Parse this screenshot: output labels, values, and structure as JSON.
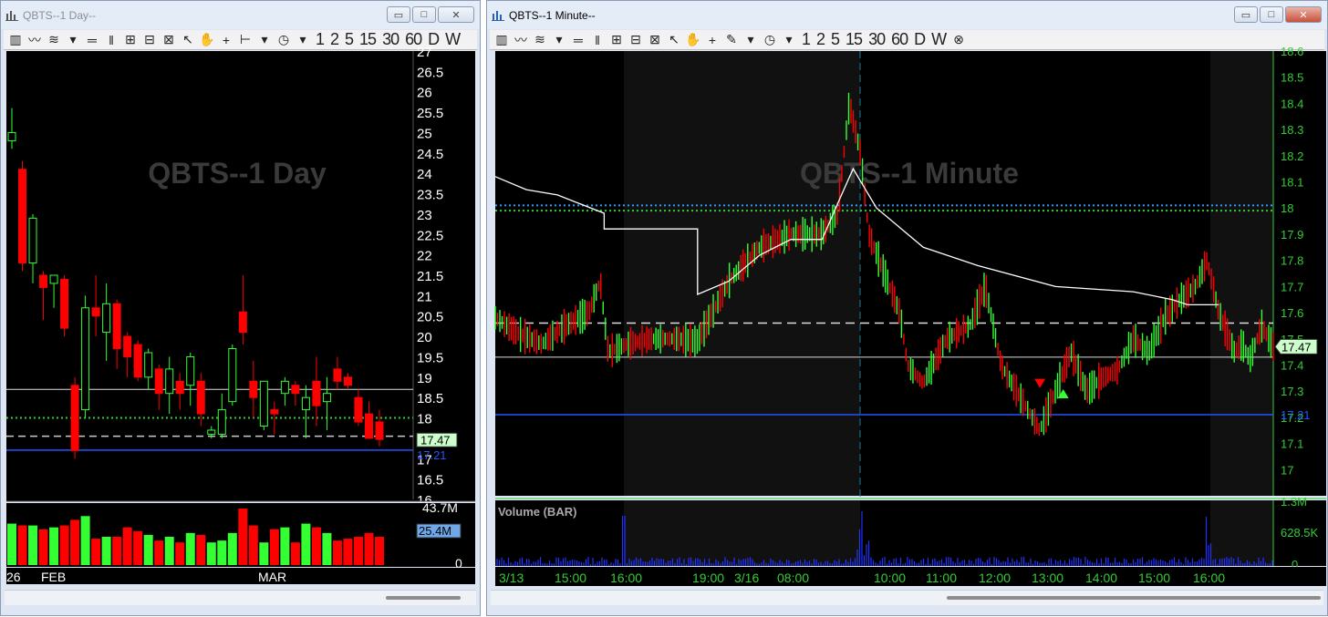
{
  "windows": {
    "day": {
      "title": "QBTS--1 Day--",
      "min": "▭",
      "max": "□",
      "close": "✕"
    },
    "minute": {
      "title": "QBTS--1 Minute--",
      "min": "▭",
      "max": "□",
      "close": "✕"
    }
  },
  "toolbar": {
    "timeframes_day": [
      "1",
      "2",
      "5",
      "15",
      "30",
      "60",
      "D",
      "W"
    ],
    "timeframes_minute": [
      "1",
      "2",
      "5",
      "15",
      "30",
      "60",
      "D",
      "W"
    ]
  },
  "colors": {
    "up": "#33ff33",
    "down": "#ff0000",
    "vwap": "#ffffff",
    "blue_line": "#2255ff",
    "dotted_green": "#33cc33",
    "dotted_blue": "#3399ff",
    "axis_minute": "#33cc33",
    "axis_day": "#ffffff",
    "last_price_tag": "#ccffcc"
  },
  "chart_data": [
    {
      "type": "candlestick",
      "title": "QBTS--1 Day",
      "y_ticks": [
        "27",
        "26.5",
        "26",
        "25.5",
        "25",
        "24.5",
        "24",
        "23.5",
        "23",
        "22.5",
        "22",
        "21.5",
        "21",
        "20.5",
        "20",
        "19.5",
        "19",
        "18.5",
        "18",
        "17.5",
        "17",
        "16.5",
        "16"
      ],
      "ylim": [
        16,
        27
      ],
      "x_labels": [
        "26",
        "FEB",
        "MAR"
      ],
      "last_price": "17.47",
      "blue_level_label": "17.21",
      "levels": {
        "white": 18.7,
        "dotted_green": 18.0,
        "dashed": 17.55,
        "blue": 17.21
      },
      "candles": [
        {
          "o": 24.8,
          "h": 25.6,
          "l": 24.6,
          "c": 25.0
        },
        {
          "o": 24.1,
          "h": 24.3,
          "l": 21.6,
          "c": 21.8
        },
        {
          "o": 21.8,
          "h": 23.0,
          "l": 21.3,
          "c": 22.9
        },
        {
          "o": 21.5,
          "h": 21.6,
          "l": 20.4,
          "c": 21.2
        },
        {
          "o": 21.3,
          "h": 21.5,
          "l": 20.7,
          "c": 21.5
        },
        {
          "o": 21.4,
          "h": 21.5,
          "l": 20.0,
          "c": 20.2
        },
        {
          "o": 18.8,
          "h": 19.0,
          "l": 17.0,
          "c": 17.2
        },
        {
          "o": 18.2,
          "h": 21.0,
          "l": 18.0,
          "c": 20.7
        },
        {
          "o": 20.7,
          "h": 21.5,
          "l": 20.0,
          "c": 20.5
        },
        {
          "o": 20.1,
          "h": 21.3,
          "l": 19.4,
          "c": 20.8
        },
        {
          "o": 20.8,
          "h": 20.9,
          "l": 19.2,
          "c": 19.7
        },
        {
          "o": 20.0,
          "h": 20.1,
          "l": 19.0,
          "c": 19.5
        },
        {
          "o": 19.8,
          "h": 19.9,
          "l": 18.9,
          "c": 19.0
        },
        {
          "o": 19.0,
          "h": 19.7,
          "l": 18.7,
          "c": 19.6
        },
        {
          "o": 19.2,
          "h": 19.3,
          "l": 18.2,
          "c": 18.6
        },
        {
          "o": 18.6,
          "h": 19.5,
          "l": 18.1,
          "c": 19.2
        },
        {
          "o": 18.9,
          "h": 19.1,
          "l": 18.2,
          "c": 18.6
        },
        {
          "o": 18.8,
          "h": 19.6,
          "l": 18.3,
          "c": 19.5
        },
        {
          "o": 18.9,
          "h": 19.1,
          "l": 17.8,
          "c": 18.1
        },
        {
          "o": 17.6,
          "h": 17.8,
          "l": 17.5,
          "c": 17.7
        },
        {
          "o": 17.6,
          "h": 18.6,
          "l": 17.5,
          "c": 18.2
        },
        {
          "o": 18.4,
          "h": 19.8,
          "l": 18.3,
          "c": 19.7
        },
        {
          "o": 20.6,
          "h": 21.5,
          "l": 19.8,
          "c": 20.1
        },
        {
          "o": 18.9,
          "h": 19.4,
          "l": 18.0,
          "c": 18.5
        },
        {
          "o": 17.8,
          "h": 18.9,
          "l": 17.7,
          "c": 18.9
        },
        {
          "o": 18.2,
          "h": 18.4,
          "l": 17.6,
          "c": 18.1
        },
        {
          "o": 18.6,
          "h": 19.0,
          "l": 18.3,
          "c": 18.9
        },
        {
          "o": 18.8,
          "h": 18.9,
          "l": 18.3,
          "c": 18.6
        },
        {
          "o": 18.2,
          "h": 18.8,
          "l": 17.5,
          "c": 18.5
        },
        {
          "o": 18.9,
          "h": 19.5,
          "l": 17.8,
          "c": 18.3
        },
        {
          "o": 18.4,
          "h": 19.0,
          "l": 17.7,
          "c": 18.6
        },
        {
          "o": 19.2,
          "h": 19.5,
          "l": 18.7,
          "c": 18.9
        },
        {
          "o": 19.0,
          "h": 19.1,
          "l": 18.7,
          "c": 18.8
        },
        {
          "o": 18.5,
          "h": 18.7,
          "l": 17.8,
          "c": 17.9
        },
        {
          "o": 18.1,
          "h": 18.4,
          "l": 17.7,
          "c": 17.5
        },
        {
          "o": 17.9,
          "h": 18.2,
          "l": 17.3,
          "c": 17.47
        }
      ],
      "volume": {
        "top_label": "43.7M",
        "tag_label": "25.4M",
        "zero_label": "0",
        "values": [
          22,
          21,
          21,
          19,
          20,
          21,
          24,
          26,
          14,
          15,
          15,
          20,
          18,
          16,
          13,
          15,
          12,
          17,
          16,
          12,
          13,
          17,
          30,
          21,
          12,
          19,
          20,
          12,
          22,
          20,
          17,
          13,
          14,
          15,
          17,
          15
        ]
      }
    },
    {
      "type": "candlestick",
      "title": "QBTS--1 Minute",
      "y_ticks": [
        "18.6",
        "18.5",
        "18.4",
        "18.3",
        "18.2",
        "18.1",
        "18",
        "17.9",
        "17.8",
        "17.7",
        "17.6",
        "17.5",
        "17.4",
        "17.3",
        "17.2",
        "17.1",
        "17"
      ],
      "ylim": [
        16.9,
        18.6
      ],
      "x_labels": [
        "3/13",
        "15:00",
        "16:00",
        "19:00",
        "3/16",
        "08:00",
        "10:00",
        "11:00",
        "12:00",
        "13:00",
        "14:00",
        "15:00",
        "16:00"
      ],
      "last_price": "17.47",
      "blue_level_label": "17.21",
      "levels": {
        "dotted_blue": 18.01,
        "dotted_green": 17.99,
        "dashed": 17.56,
        "white": 17.43,
        "blue": 17.21
      },
      "vwap": [
        [
          0,
          18.12
        ],
        [
          0.04,
          18.07
        ],
        [
          0.08,
          18.05
        ],
        [
          0.14,
          17.98
        ],
        [
          0.14,
          17.92
        ],
        [
          0.26,
          17.92
        ],
        [
          0.26,
          17.67
        ],
        [
          0.3,
          17.72
        ],
        [
          0.34,
          17.82
        ],
        [
          0.38,
          17.88
        ],
        [
          0.42,
          17.88
        ],
        [
          0.445,
          18.05
        ],
        [
          0.46,
          18.15
        ],
        [
          0.49,
          18.0
        ],
        [
          0.55,
          17.85
        ],
        [
          0.62,
          17.78
        ],
        [
          0.72,
          17.7
        ],
        [
          0.82,
          17.68
        ],
        [
          0.87,
          17.65
        ],
        [
          0.89,
          17.63
        ],
        [
          0.93,
          17.63
        ]
      ],
      "price_path": [
        [
          0,
          17.58
        ],
        [
          0.03,
          17.52
        ],
        [
          0.06,
          17.48
        ],
        [
          0.09,
          17.55
        ],
        [
          0.12,
          17.6
        ],
        [
          0.135,
          17.72
        ],
        [
          0.14,
          17.58
        ],
        [
          0.145,
          17.45
        ],
        [
          0.17,
          17.48
        ],
        [
          0.2,
          17.5
        ],
        [
          0.235,
          17.5
        ],
        [
          0.26,
          17.49
        ],
        [
          0.3,
          17.72
        ],
        [
          0.34,
          17.85
        ],
        [
          0.38,
          17.9
        ],
        [
          0.42,
          17.9
        ],
        [
          0.44,
          17.98
        ],
        [
          0.455,
          18.4
        ],
        [
          0.47,
          18.2
        ],
        [
          0.48,
          17.9
        ],
        [
          0.5,
          17.75
        ],
        [
          0.52,
          17.6
        ],
        [
          0.53,
          17.4
        ],
        [
          0.55,
          17.33
        ],
        [
          0.58,
          17.5
        ],
        [
          0.61,
          17.55
        ],
        [
          0.63,
          17.7
        ],
        [
          0.65,
          17.4
        ],
        [
          0.67,
          17.3
        ],
        [
          0.7,
          17.15
        ],
        [
          0.72,
          17.3
        ],
        [
          0.74,
          17.45
        ],
        [
          0.76,
          17.3
        ],
        [
          0.78,
          17.35
        ],
        [
          0.8,
          17.38
        ],
        [
          0.82,
          17.5
        ],
        [
          0.84,
          17.45
        ],
        [
          0.86,
          17.58
        ],
        [
          0.88,
          17.65
        ],
        [
          0.9,
          17.7
        ],
        [
          0.915,
          17.8
        ],
        [
          0.93,
          17.6
        ],
        [
          0.95,
          17.45
        ],
        [
          0.96,
          17.48
        ],
        [
          0.97,
          17.42
        ],
        [
          0.985,
          17.55
        ],
        [
          1.0,
          17.47
        ]
      ],
      "markers": [
        {
          "type": "down",
          "x": 0.7,
          "price": 17.33
        },
        {
          "type": "up",
          "x": 0.73,
          "price": 17.29
        }
      ],
      "volume": {
        "label": "Volume (BAR)",
        "top_label": "1.3M",
        "mid_label": "628.5K",
        "zero_label": "0"
      }
    }
  ]
}
